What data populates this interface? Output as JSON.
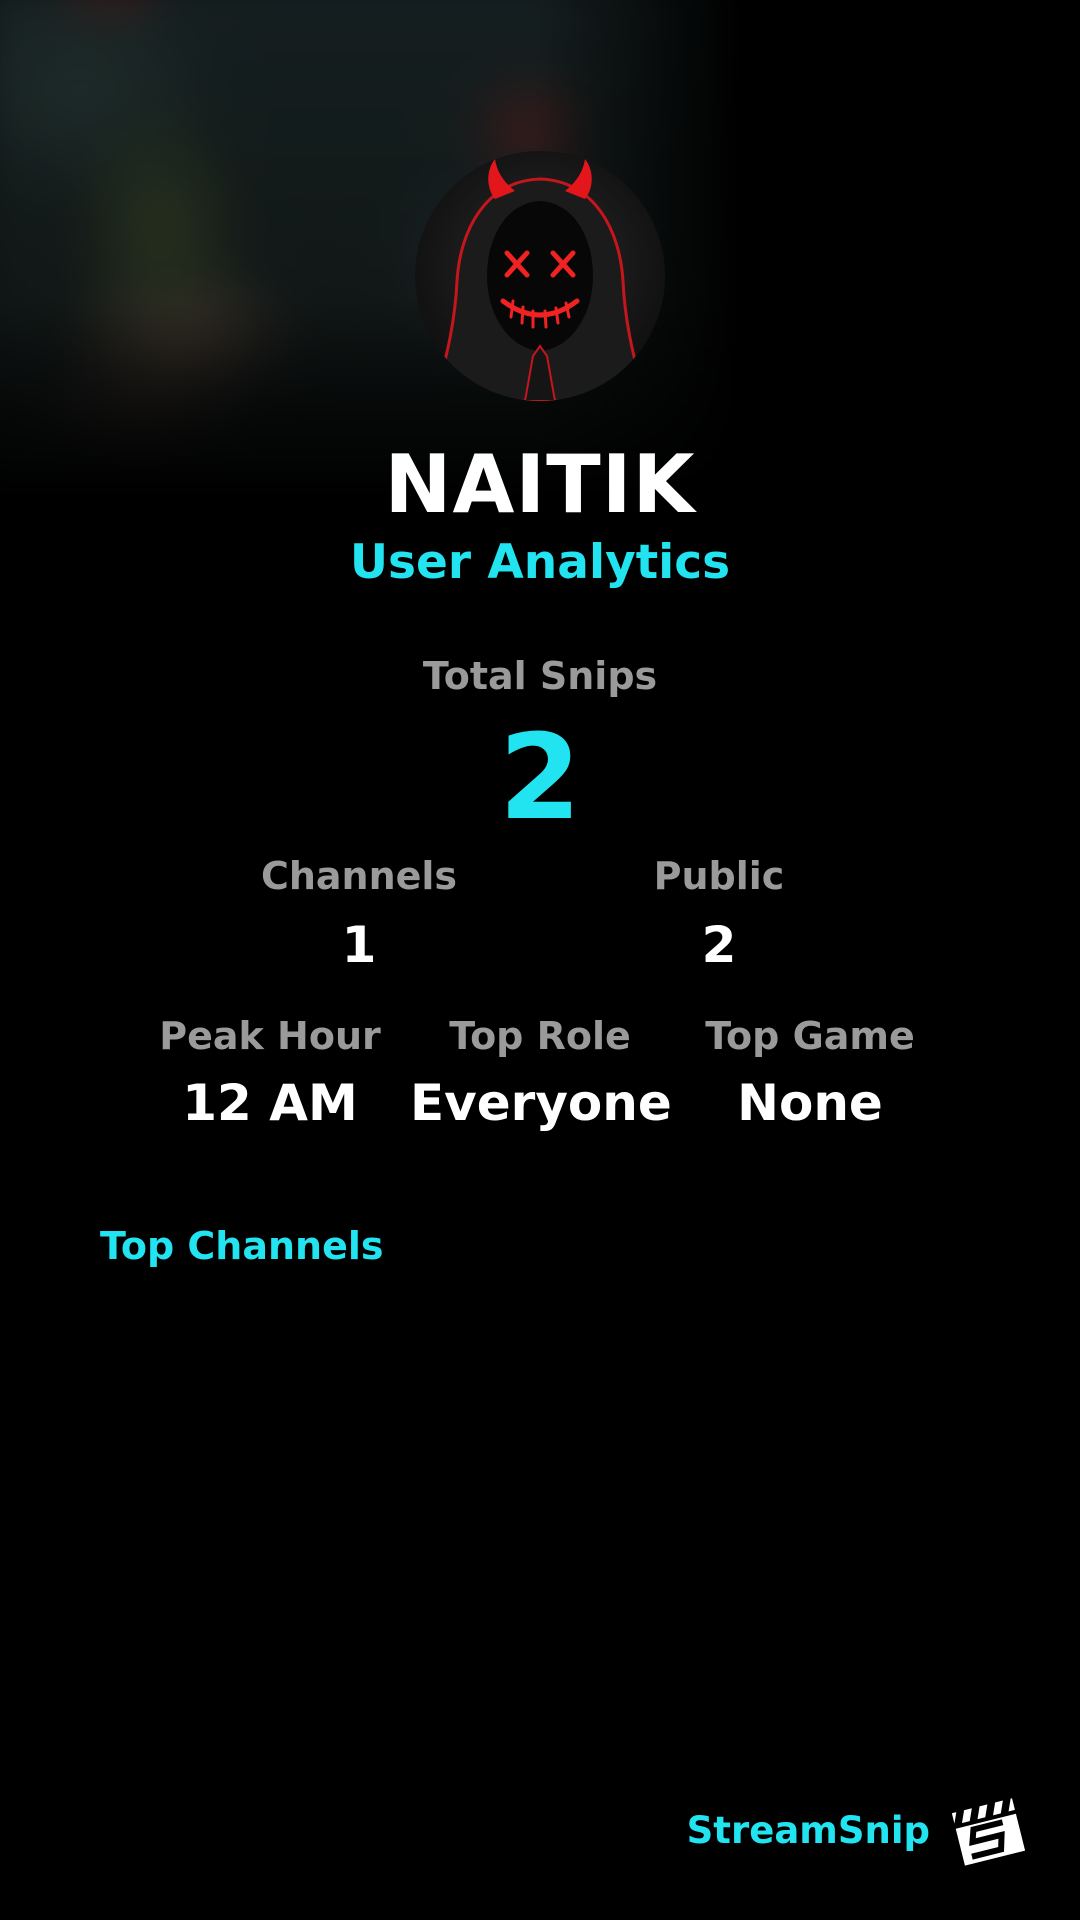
{
  "profile": {
    "username": "NAITIK",
    "subtitle": "User Analytics",
    "avatar_icon": "hooded-devil-avatar"
  },
  "stats": {
    "total_snips": {
      "label": "Total Snips",
      "value": "2"
    },
    "channels": {
      "label": "Channels",
      "value": "1"
    },
    "public": {
      "label": "Public",
      "value": "2"
    },
    "peak_hour": {
      "label": "Peak Hour",
      "value": "12 AM"
    },
    "top_role": {
      "label": "Top Role",
      "value": "Everyone"
    },
    "top_game": {
      "label": "Top Game",
      "value": "None"
    }
  },
  "sections": {
    "top_channels_title": "Top Channels",
    "top_channels": []
  },
  "footer": {
    "brand_name": "StreamSnip",
    "brand_icon": "clapperboard-logo-icon"
  },
  "colors": {
    "background": "#000000",
    "accent": "#22e3f0",
    "label_gray": "#9a9a9a",
    "value_white": "#ffffff"
  }
}
